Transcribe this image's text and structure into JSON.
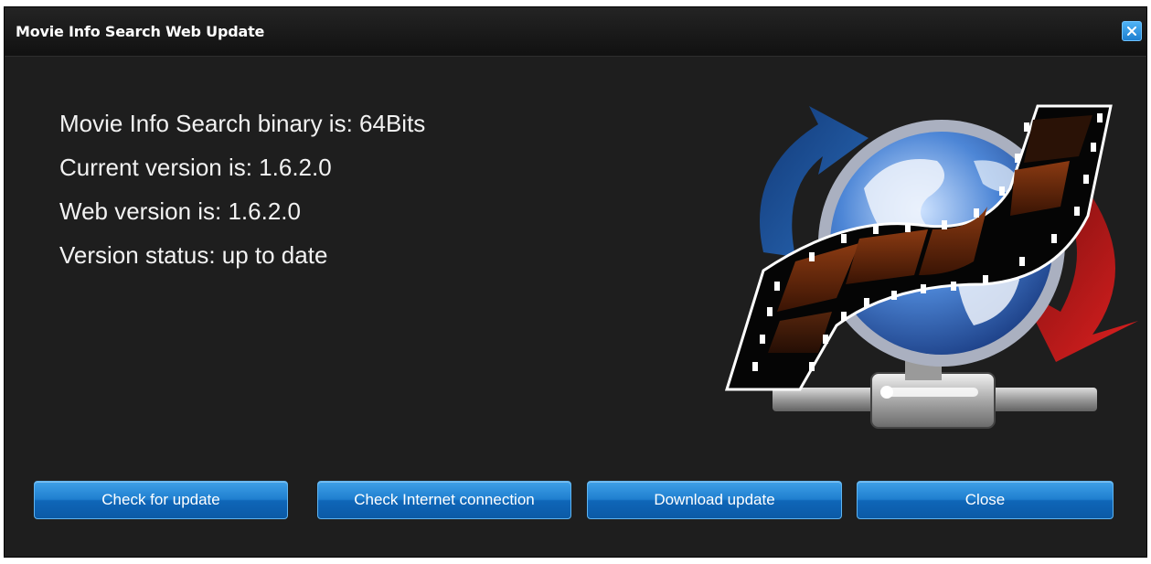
{
  "window": {
    "title": "Movie Info Search Web Update",
    "close_icon": "close-icon"
  },
  "info": {
    "binary": "Movie Info Search binary is: 64Bits",
    "current_version": "Current version is: 1.6.2.0",
    "web_version": "Web version is: 1.6.2.0",
    "status": "Version status: up to date"
  },
  "logo": {
    "icon": "globe-film-network-icon"
  },
  "buttons": {
    "check_update": "Check for update",
    "check_internet": "Check Internet connection",
    "download_update": "Download update",
    "close": "Close"
  },
  "colors": {
    "background": "#1e1e1e",
    "titlebar": "#141414",
    "button_accent": "#1f7fcf",
    "text": "#f2f2f2"
  }
}
